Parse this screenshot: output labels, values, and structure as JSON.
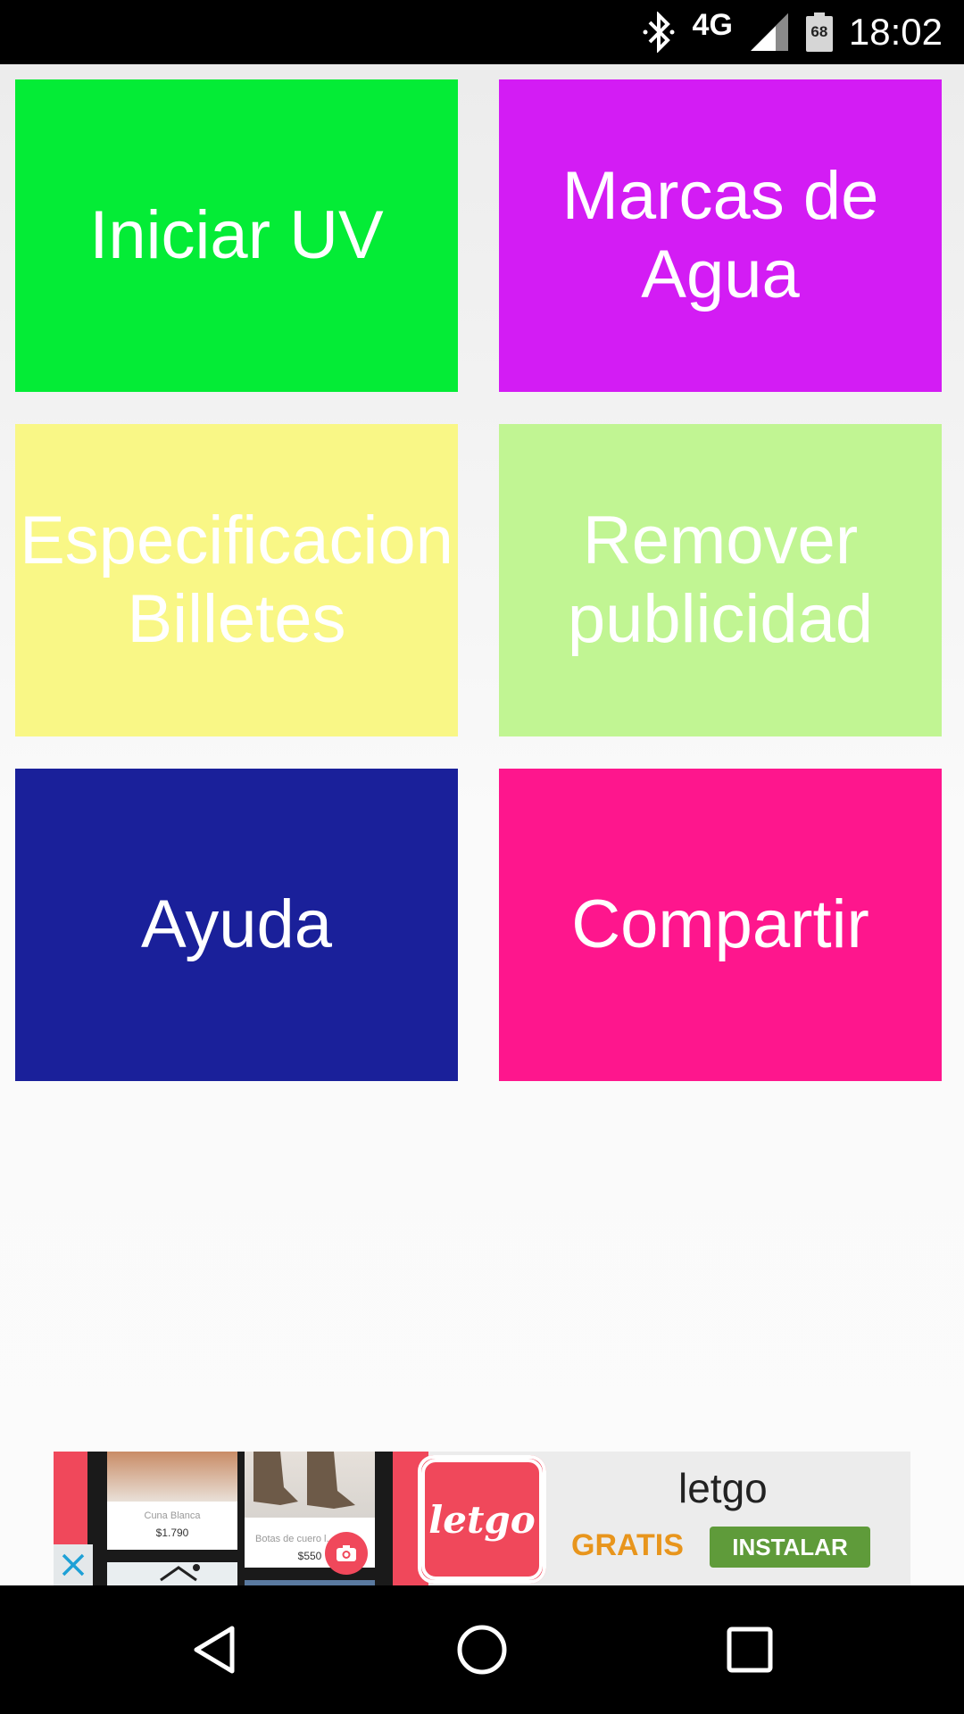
{
  "status_bar": {
    "network": "4G",
    "battery_level": "68",
    "time": "18:02"
  },
  "tiles": [
    {
      "label": "Iniciar UV",
      "color": "#04ec36"
    },
    {
      "label": "Marcas de\nAgua",
      "color": "#d31cf4"
    },
    {
      "label": "Especificacion\nBilletes",
      "color": "#f9f786"
    },
    {
      "label": "Remover\npublicidad",
      "color": "#c1f593"
    },
    {
      "label": "Ayuda",
      "color": "#1a209a"
    },
    {
      "label": "Compartir",
      "color": "#fe168d"
    }
  ],
  "ad": {
    "card1_caption": "Cuna Blanca",
    "card1_price": "$1.790",
    "card2_caption": "Botas de cuero l...",
    "card2_price": "$550",
    "logo_text": "letgo",
    "brand": "letgo",
    "free_label": "GRATIS",
    "install_label": "INSTALAR"
  }
}
